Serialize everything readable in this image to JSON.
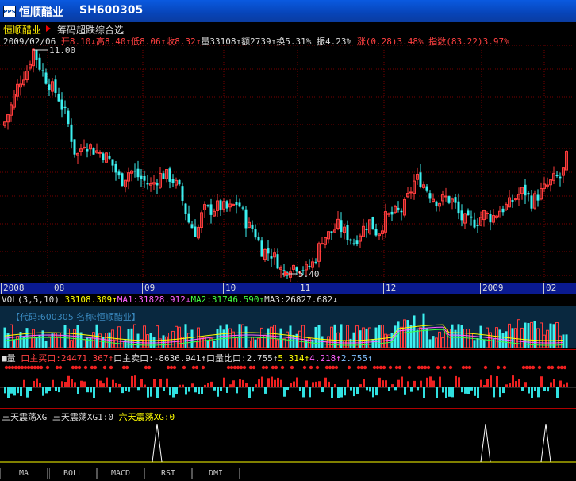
{
  "window": {
    "icon_label": "PPS",
    "title": "恒顺醋业",
    "code": "SH600305"
  },
  "stock_bar": {
    "name": "恒顺醋业",
    "formula": "筹码超跌综合选"
  },
  "quote": [
    {
      "text": "2009/02/06",
      "color": "#dddddd"
    },
    {
      "text": " 开8.10↓",
      "color": "#ff4040"
    },
    {
      "text": "高8.40↑",
      "color": "#ff4040"
    },
    {
      "text": "低8.06↑",
      "color": "#ff4040"
    },
    {
      "text": "收8.32↑",
      "color": "#ff4040"
    },
    {
      "text": "量33108↑",
      "color": "#dddddd"
    },
    {
      "text": "额2739↑",
      "color": "#dddddd"
    },
    {
      "text": "换5.31%",
      "color": "#dddddd"
    },
    {
      "text": " 振4.23%",
      "color": "#dddddd"
    },
    {
      "text": " 涨(0.28)3.48%",
      "color": "#ff4040"
    },
    {
      "text": " 指数(83.22)3.97%",
      "color": "#ff4040"
    }
  ],
  "main_chart": {
    "high_label": "11.00",
    "low_label": "5.40",
    "high_value": 11.0,
    "low_value": 5.4,
    "up_color": "#ff3c3c",
    "down_color": "#3cf0f0",
    "grid_color": "#7a0000"
  },
  "date_axis": [
    "2008",
    "08",
    "09",
    "10",
    "11",
    "12",
    "2009",
    "02"
  ],
  "volume": {
    "header": [
      {
        "text": "VOL(3,5,10) ",
        "color": "#dddddd"
      },
      {
        "text": "33108.309↑",
        "color": "#ffff00"
      },
      {
        "text": "MA1:31828.912↓",
        "color": "#ff60ff"
      },
      {
        "text": "MA2:31746.590↑",
        "color": "#40ff40"
      },
      {
        "text": "MA3:26827.682↓",
        "color": "#dddddd"
      }
    ],
    "info": "【代码:600305 名称:恒顺醋业】"
  },
  "flow": {
    "header": [
      {
        "text": "■量 ",
        "color": "#dddddd"
      },
      {
        "text": "口主买口:24471.367↑",
        "color": "#ff4040"
      },
      {
        "text": "口主卖口:-8636.941↑",
        "color": "#dddddd"
      },
      {
        "text": "口量比口:2.755↑",
        "color": "#dddddd"
      },
      {
        "text": "5.314↑",
        "color": "#ffff00"
      },
      {
        "text": "4.218↑",
        "color": "#ff60ff"
      },
      {
        "text": "2.755↑",
        "color": "#80c0ff"
      }
    ]
  },
  "signal": {
    "header": [
      {
        "text": "三天震荡XG ",
        "color": "#dddddd"
      },
      {
        "text": "三天震荡XG1:0 ",
        "color": "#dddddd"
      },
      {
        "text": "六天震荡XG:0",
        "color": "#ffff00"
      }
    ]
  },
  "tabs": [
    "MA",
    "BOLL",
    "MACD",
    "RSI",
    "DMI"
  ]
}
